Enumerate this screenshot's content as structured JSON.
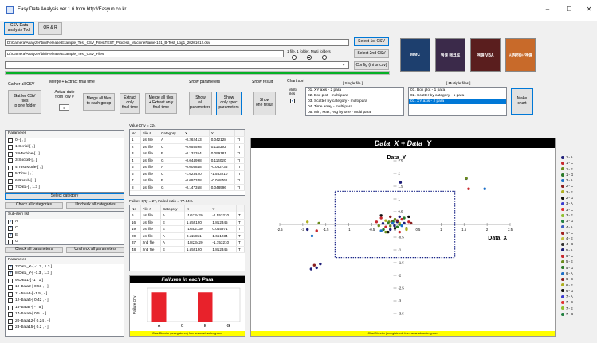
{
  "window": {
    "title": "Easy Data Analysis ver 1.6 from http://Easyun.co.kr"
  },
  "toolbar": {
    "csv_tool": "CSV Data\nanalysis Tool",
    "qa": "QR & R"
  },
  "paths": {
    "file_path": "D:\\Camera\\Analyzer\\bin\\Release\\Example_Test_CSV_Files\\TEST_Process_MachineName-101_B-Test_Log1_20201012.csv",
    "folder_path": "D:\\Camera\\Analyzer\\bin\\Release\\Example_Test_CSV_Files",
    "combo_value": ""
  },
  "file_buttons": {
    "select_1st": "Select 1st CSV",
    "select_2nd": "Select 2nd CSV",
    "config": "Config (ini or csv)"
  },
  "file_mode": {
    "label": "1 file, 1 folder, Multi folders",
    "selected_index": 1
  },
  "progress": {
    "percent": 100
  },
  "books": [
    {
      "title": "MMC",
      "color": "#1d3f6e"
    },
    {
      "title": "엑셀 매크로",
      "color": "#3b2a4a"
    },
    {
      "title": "엑셀 VBA",
      "color": "#5a1e1e"
    },
    {
      "title": "시작하는 엑셀",
      "color": "#c86a2a"
    }
  ],
  "groups": {
    "gather": "Gather all CSV",
    "merge": "Merge + Extract final time",
    "show_params": "Show parameters",
    "show_result": "Show result",
    "chart_sort": "Chart sort"
  },
  "actions": {
    "gather_btn": "Gather CSV\nfiles\nto one folder",
    "actual_date_label": "Actual date\nfrom row #",
    "actual_date_value": "4",
    "merge_all": "Merge all files\nto each group",
    "extract_only": "Extract\nonly\nfinal time",
    "merge_extract": "Merge all files\n+ Extract only\nfinal time",
    "show_all": "Show\nall\nparameters",
    "show_spec": "Show\nonly spec\nparameters",
    "show_one": "Show\none result",
    "multi_files": "Multi\nfiles",
    "make_chart": "Make\nchart"
  },
  "single_file": {
    "header": "[ Single file ]",
    "items": [
      "01. XY axis - 2 para",
      "02. Box plot - multi para",
      "03. Scatter by category - multi para",
      "04. Time array - multi para",
      "05. Min, Max, Avg by one - Multi para",
      "06. Each data by ... - Multi para"
    ]
  },
  "multi_files_list": {
    "header": "[ Multiple files ]",
    "items": [
      "01. Box plot - 1 para",
      "02. Scatter by category - 1 para",
      "03. XY axis - 2 para"
    ],
    "selected": 2
  },
  "parameters": {
    "header": "Parameter",
    "items": [
      "0--[ , ]",
      "1-Serial-[ , ]",
      "2-Machine-[ , ]",
      "3-Socket-[ , ]",
      "4-Test Mode-[ , ]",
      "5-Time-[ , ]",
      "6-Result-[ , ]",
      "7-Data-[ , 1.3 ]"
    ],
    "select_category": "Select category",
    "check_all": "Check all categories",
    "uncheck_all": "Uncheck all categories"
  },
  "subitems": {
    "header": "Sub-item list",
    "items": [
      {
        "label": "A",
        "checked": true
      },
      {
        "label": "C",
        "checked": true
      },
      {
        "label": "E",
        "checked": true
      },
      {
        "label": "G",
        "checked": false
      }
    ],
    "check_all": "Check all parameters",
    "uncheck_all": "Uncheck all parameters"
  },
  "parameters2": {
    "header": "Parameter",
    "items": [
      {
        "label": "7-Data_X-[ -1.3 , 1.3 ]",
        "checked": true
      },
      {
        "label": "8-Data_Y-[ -1.3 , 1.3 ]",
        "checked": true
      },
      {
        "label": "9-Data1-[ -1 , 1 ]",
        "checked": false
      },
      {
        "label": "10-Data2-[ 0.51 , - ]",
        "checked": false
      },
      {
        "label": "11-Data3-[ -1.5 , - ]",
        "checked": false
      },
      {
        "label": "12-Data4-[ 0.42 , - ]",
        "checked": false
      },
      {
        "label": "15-Data7-[ - , 5 ]",
        "checked": false
      },
      {
        "label": "17-Data9-[ 0.5 , - ]",
        "checked": false
      },
      {
        "label": "20-Data12-[ 0.24 , - ]",
        "checked": false
      },
      {
        "label": "23-Data15-[ 0.2 , - ]",
        "checked": false
      }
    ]
  },
  "value_table": {
    "summary": "Value Q'ty = 224",
    "columns": [
      "No",
      "File #",
      "Category",
      "X",
      "Y",
      ""
    ],
    "rows": [
      [
        "1",
        "1st file",
        "A",
        "-0.262413",
        "0.042128",
        "TI"
      ],
      [
        "2",
        "1st file",
        "C",
        "-0.055598",
        "0.115393",
        "TI"
      ],
      [
        "3",
        "1st file",
        "E",
        "-0.132354",
        "0.099181",
        "TI"
      ],
      [
        "4",
        "1st file",
        "G",
        "-0.044998",
        "0.114020",
        "TI"
      ],
      [
        "5",
        "1st file",
        "A",
        "-0.005848",
        "-0.052736",
        "TI"
      ],
      [
        "6",
        "1st file",
        "C",
        "-1.623420",
        "-1.553210",
        "TI"
      ],
      [
        "7",
        "1st file",
        "E",
        "-0.097348",
        "-0.058761",
        "TI"
      ],
      [
        "8",
        "1st file",
        "G",
        "-0.147358",
        "0.048996",
        "TI"
      ]
    ]
  },
  "failure_table": {
    "summary": "Failure Q'ty = 27, Failed ratio = 77.14%",
    "columns": [
      "No",
      "File #",
      "Category",
      "X",
      "Y",
      ""
    ],
    "rows": [
      [
        "6",
        "1st file",
        "A",
        "-1.623420",
        "-1.553210",
        "T"
      ],
      [
        "16",
        "1st file",
        "E",
        "1.552120",
        "1.812345",
        "T"
      ],
      [
        "19",
        "1st file",
        "E",
        "-1.652130",
        "0.045971",
        "T"
      ],
      [
        "20",
        "1st file",
        "A",
        "0.115851",
        "1.651234",
        "T"
      ],
      [
        "37",
        "2nd file",
        "A",
        "-1.823420",
        "-1.753210",
        "T"
      ],
      [
        "48",
        "2nd file",
        "E",
        "1.552120",
        "1.812345",
        "T"
      ]
    ]
  },
  "bar_chart": {
    "chart_data": {
      "type": "bar",
      "title": "Failures in each Para",
      "categories": [
        "A",
        "C",
        "E",
        "G"
      ],
      "values": [
        14,
        0,
        14,
        0
      ],
      "ylabel": "Failure Q'ty",
      "color": "#e8222b"
    },
    "footer": "ChartDirector (unregistered) from www.advsofteng.com"
  },
  "scatter_chart": {
    "chart_data": {
      "type": "scatter",
      "title": "Data_X + Data_Y",
      "xlabel": "Data_X",
      "ylabel": "Data_Y",
      "xlim": [
        -2.5,
        2.5
      ],
      "ylim": [
        -3.5,
        2.5
      ],
      "x_ticks": [
        "-2.5",
        "-2",
        "-1.5",
        "-1",
        "-0.5",
        "0",
        "0.5",
        "1",
        "1.5",
        "2",
        "2.5"
      ],
      "y_ticks": [
        "2.5",
        "2",
        "1.5",
        "1",
        "0.5",
        "0",
        "-0.5",
        "-1",
        "-1.5",
        "-2",
        "-2.5",
        "-3",
        "-3.5"
      ],
      "spec_box": {
        "x": [
          -1.3,
          1.3
        ],
        "y": [
          -1.3,
          1.3
        ]
      },
      "series": [
        {
          "name": "1 - A",
          "color": "#1f1f7a",
          "points": [
            [
              -1.62,
              -1.55
            ],
            [
              -1.82,
              -1.75
            ],
            [
              0.12,
              1.65
            ],
            [
              -0.26,
              0.04
            ],
            [
              -0.01,
              -0.05
            ],
            [
              0.05,
              0.1
            ],
            [
              -0.1,
              -0.2
            ],
            [
              0.2,
              0.05
            ],
            [
              1.55,
              1.8
            ],
            [
              -1.9,
              -0.2
            ],
            [
              -1.7,
              -1.7
            ],
            [
              0.1,
              0.3
            ]
          ]
        },
        {
          "name": "1 - C",
          "color": "#c8282d",
          "points": [
            [
              -0.06,
              0.12
            ],
            [
              -0.2,
              -0.1
            ],
            [
              0.15,
              0.2
            ],
            [
              -0.3,
              0.25
            ],
            [
              0.1,
              -0.3
            ],
            [
              -1.7,
              -0.25
            ],
            [
              1.6,
              1.4
            ],
            [
              -0.4,
              0.1
            ],
            [
              0.3,
              0.1
            ]
          ]
        },
        {
          "name": "1 - E",
          "color": "#6b8c1c",
          "points": [
            [
              -0.13,
              0.1
            ],
            [
              -0.1,
              -0.06
            ],
            [
              1.55,
              1.81
            ],
            [
              -1.65,
              0.05
            ],
            [
              0.0,
              0.2
            ],
            [
              -0.2,
              -0.3
            ],
            [
              0.25,
              -0.15
            ],
            [
              -0.35,
              -0.05
            ]
          ]
        },
        {
          "name": "1 - G",
          "color": "#2a7a2a",
          "points": [
            [
              -0.04,
              0.11
            ],
            [
              -0.15,
              0.05
            ],
            [
              0.05,
              -0.1
            ],
            [
              0.2,
              0.25
            ],
            [
              -0.25,
              -0.2
            ],
            [
              0.1,
              0.0
            ]
          ]
        },
        {
          "name": "2 - A",
          "color": "#1b6fc8",
          "points": [
            [
              -1.8,
              -0.45
            ],
            [
              1.95,
              1.4
            ],
            [
              -0.05,
              0.05
            ],
            [
              0.15,
              -0.05
            ],
            [
              -0.3,
              -0.25
            ]
          ]
        },
        {
          "name": "2 - C",
          "color": "#8a1f1f",
          "points": [
            [
              -1.75,
              -1.6
            ],
            [
              0.05,
              0.15
            ],
            [
              -0.1,
              0.3
            ],
            [
              0.35,
              0.05
            ]
          ]
        },
        {
          "name": "2 - E",
          "color": "#b0b020",
          "points": [
            [
              -1.9,
              0.1
            ],
            [
              0.1,
              0.05
            ],
            [
              -0.2,
              0.15
            ],
            [
              0.25,
              -0.2
            ]
          ]
        },
        {
          "name": "2 - G",
          "color": "#111111",
          "points": [
            [
              -0.15,
              -0.3
            ],
            [
              0.0,
              -0.15
            ],
            [
              0.3,
              0.3
            ],
            [
              -0.3,
              0.35
            ]
          ]
        }
      ],
      "legend": [
        "1 - A",
        "1 - C",
        "1 - E",
        "1 - G",
        "2 - A",
        "2 - C",
        "2 - E",
        "2 - G",
        "3 - A",
        "3 - C",
        "3 - E",
        "3 - G",
        "4 - A",
        "4 - C",
        "4 - E",
        "4 - G",
        "5 - A",
        "5 - C",
        "5 - E",
        "5 - G",
        "6 - A",
        "6 - C",
        "6 - E",
        "6 - G",
        "7 - A",
        "7 - C",
        "7 - E",
        "7 - G"
      ],
      "legend_colors": [
        "#1f1f7a",
        "#c8282d",
        "#6b8c1c",
        "#2a7a2a",
        "#1b6fc8",
        "#8a1f1f",
        "#b0b020",
        "#111111",
        "#3a3ad0",
        "#e03030",
        "#90c030",
        "#208040",
        "#4060c0",
        "#a02020",
        "#c0c040",
        "#303030",
        "#1f1f7a",
        "#c8282d",
        "#6b8c1c",
        "#2a7a2a",
        "#1b6fc8",
        "#8a1f1f",
        "#b0b020",
        "#111111",
        "#3a3ad0",
        "#e03030",
        "#90c030",
        "#208040"
      ]
    },
    "footer": "ChartDirector (unregistered) from www.advsofteng.com"
  }
}
